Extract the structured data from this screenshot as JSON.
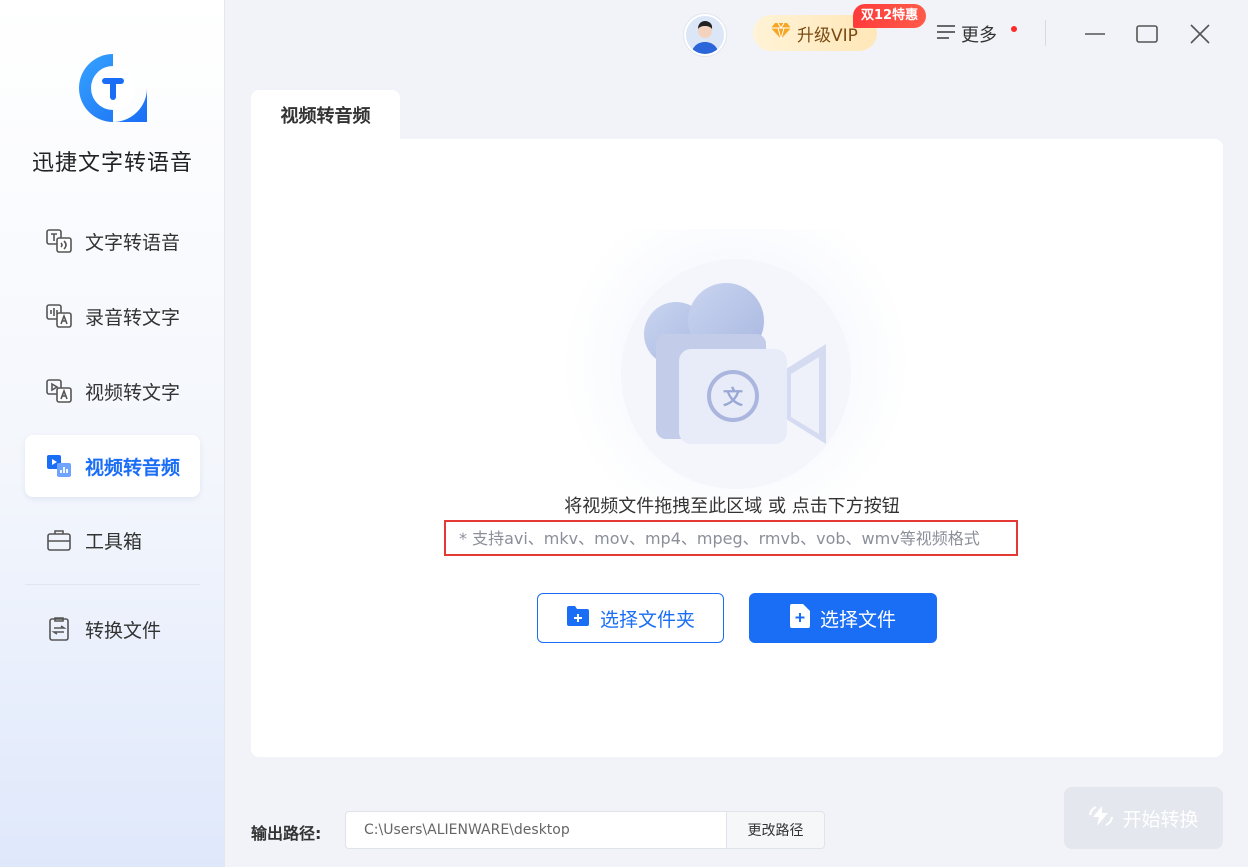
{
  "app": {
    "name": "迅捷文字转语音"
  },
  "sidebar": {
    "items": [
      {
        "label": "文字转语音",
        "icon": "text-to-speech-icon"
      },
      {
        "label": "录音转文字",
        "icon": "audio-to-text-icon"
      },
      {
        "label": "视频转文字",
        "icon": "video-to-text-icon"
      },
      {
        "label": "视频转音频",
        "icon": "video-to-audio-icon",
        "active": true
      },
      {
        "label": "工具箱",
        "icon": "toolbox-icon"
      },
      {
        "label": "转换文件",
        "icon": "converted-files-icon"
      }
    ]
  },
  "titlebar": {
    "vip_label": "升级VIP",
    "promo_badge": "双12特惠",
    "more_label": "更多"
  },
  "main": {
    "tab_label": "视频转音频",
    "drop_text": "将视频文件拖拽至此区域 或 点击下方按钮",
    "formats_text": "* 支持avi、mkv、mov、mp4、mpeg、rmvb、vob、wmv等视频格式",
    "select_folder_label": "选择文件夹",
    "select_file_label": "选择文件"
  },
  "output": {
    "label": "输出路径:",
    "path": "C:\\Users\\ALIENWARE\\desktop",
    "change_label": "更改路径",
    "start_label": "开始转换"
  },
  "colors": {
    "accent": "#1a6ef5",
    "highlight_box": "#e53935",
    "promo": "#ff3b3b"
  }
}
